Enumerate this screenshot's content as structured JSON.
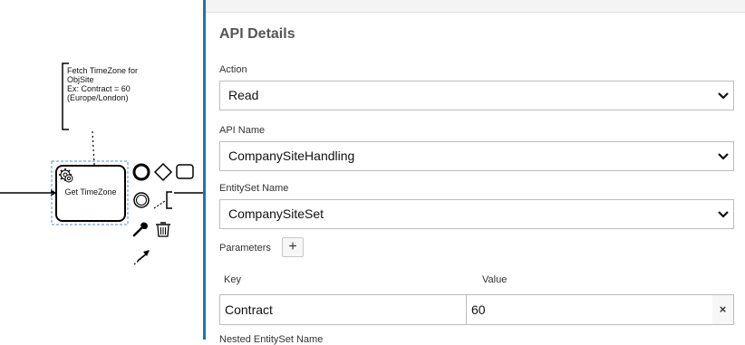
{
  "canvas": {
    "annotation_lines": [
      "Fetch TimeZone for",
      "ObjSite",
      "Ex: Contract = 60",
      "(Europe/London)"
    ],
    "task_label": "Get TimeZone",
    "context_pad": [
      "end-event-icon",
      "gateway-icon",
      "task-icon",
      "intermediate-event-icon",
      "text-annotation-icon",
      "wrench-icon",
      "trash-icon",
      "connect-icon"
    ]
  },
  "panel": {
    "title": "API Details",
    "action": {
      "label": "Action",
      "value": "Read"
    },
    "api_name": {
      "label": "API Name",
      "value": "CompanySiteHandling"
    },
    "entityset": {
      "label": "EntitySet Name",
      "value": "CompanySiteSet"
    },
    "parameters": {
      "label": "Parameters",
      "add_symbol": "+",
      "columns": [
        "Key",
        "Value"
      ],
      "rows": [
        {
          "key": "Contract",
          "value": "60",
          "delete_symbol": "×"
        }
      ]
    },
    "next_label_partial": "Nested EntitySet Name"
  },
  "colors": {
    "divider": "#1f73b7",
    "selection": "#4a90e2"
  }
}
